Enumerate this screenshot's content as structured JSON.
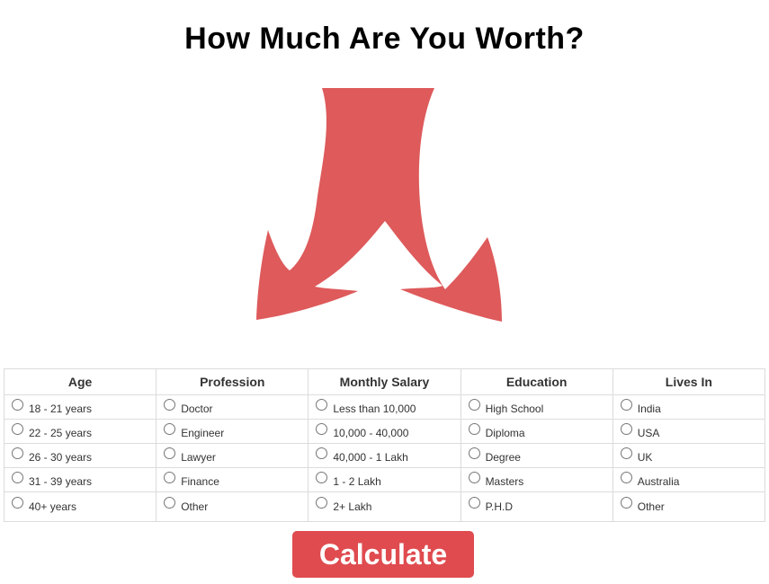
{
  "page": {
    "title": "How Much Are You Worth?"
  },
  "graphic": {
    "icon": "split-arrow-icon",
    "color": "#de5a5b"
  },
  "form": {
    "columns": [
      {
        "header": "Age",
        "options": [
          "18 - 21 years",
          "22 - 25 years",
          "26 - 30 years",
          "31 - 39 years",
          "40+ years"
        ]
      },
      {
        "header": "Profession",
        "options": [
          "Doctor",
          "Engineer",
          "Lawyer",
          "Finance",
          "Other"
        ]
      },
      {
        "header": "Monthly Salary",
        "options": [
          "Less than 10,000",
          "10,000 - 40,000",
          "40,000 - 1 Lakh",
          "1 - 2 Lakh",
          "2+ Lakh"
        ]
      },
      {
        "header": "Education",
        "options": [
          "High School",
          "Diploma",
          "Degree",
          "Masters",
          "P.H.D"
        ]
      },
      {
        "header": "Lives In",
        "options": [
          "India",
          "USA",
          "UK",
          "Australia",
          "Other"
        ]
      }
    ]
  },
  "actions": {
    "calculate_label": "Calculate",
    "button_color": "#df4b4f"
  }
}
